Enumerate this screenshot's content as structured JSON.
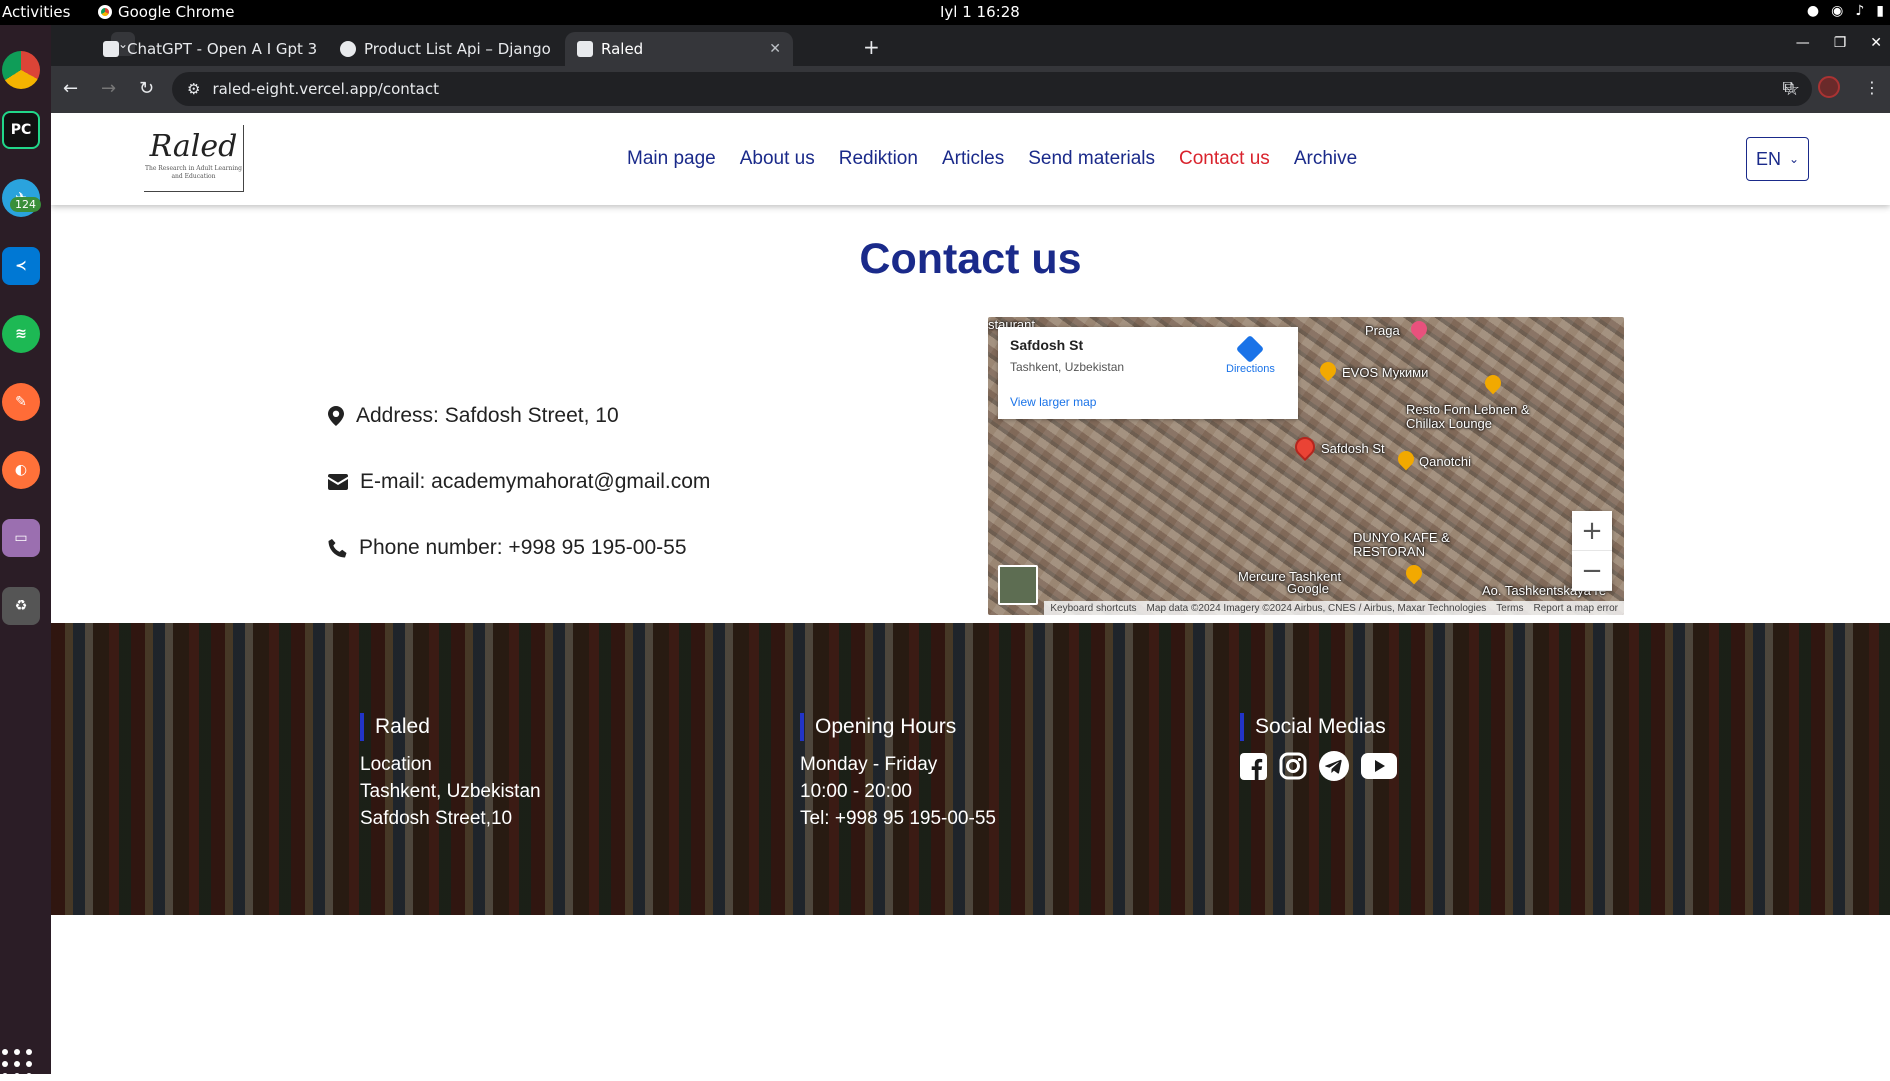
{
  "os": {
    "activities": "Activities",
    "app_name": "Google Chrome",
    "clock": "Iyl 1  16:28",
    "dock_badge": "124"
  },
  "browser": {
    "tabs": [
      {
        "title": "ChatGPT - Open A I Gpt 3",
        "active": false
      },
      {
        "title": "Product List Api – Django",
        "active": false
      },
      {
        "title": "Raled",
        "active": true
      }
    ],
    "url": "raled-eight.vercel.app/contact"
  },
  "site": {
    "logo": {
      "mark": "Raled",
      "sub": "The Research in Adult Learning and Education"
    },
    "nav": [
      {
        "label": "Main page",
        "active": false
      },
      {
        "label": "About us",
        "active": false
      },
      {
        "label": "Rediktion",
        "active": false
      },
      {
        "label": "Articles",
        "active": false
      },
      {
        "label": "Send materials",
        "active": false
      },
      {
        "label": "Contact us",
        "active": true
      },
      {
        "label": "Archive",
        "active": false
      }
    ],
    "language": "EN"
  },
  "contact": {
    "title": "Contact us",
    "address": "Address: Safdosh Street, 10",
    "email": "E-mail: academymahorat@gmail.com",
    "phone": "Phone number: +998 95 195-00-55"
  },
  "map": {
    "place": "Safdosh St",
    "address": "Tashkent, Uzbekistan",
    "directions": "Directions",
    "larger_map": "View larger map",
    "labels": {
      "restaurant": "staurant",
      "praga": "Praga",
      "evos": "EVOS Мукими",
      "resto": "Resto Forn Lebnen & Chillax Lounge",
      "safdosh": "Safdosh St",
      "qanotchi": "Qanotchi",
      "dunyo": "DUNYO KAFE & RESTORAN",
      "mercure": "Mercure Tashkent",
      "tashkent": "Ao. Tashkentskaya re",
      "google": "Google"
    },
    "footer": {
      "shortcuts": "Keyboard shortcuts",
      "data": "Map data ©2024 Imagery ©2024 Airbus, CNES / Airbus, Maxar Technologies",
      "terms": "Terms",
      "report": "Report a map error"
    }
  },
  "footer": {
    "col1": {
      "title": "Raled",
      "lines": [
        "Location",
        "Tashkent, Uzbekistan",
        "Safdosh Street,10"
      ]
    },
    "col2": {
      "title": "Opening Hours",
      "lines": [
        "Monday - Friday",
        "10:00 - 20:00",
        "Tel: +998 95 195-00-55"
      ]
    },
    "col3": {
      "title": "Social Medias",
      "icons": [
        "facebook-icon",
        "instagram-icon",
        "telegram-icon",
        "youtube-icon"
      ]
    }
  },
  "colors": {
    "brand_blue": "#1a2a8a",
    "active_red": "#d9232d",
    "footer_accent": "#2234c8"
  }
}
